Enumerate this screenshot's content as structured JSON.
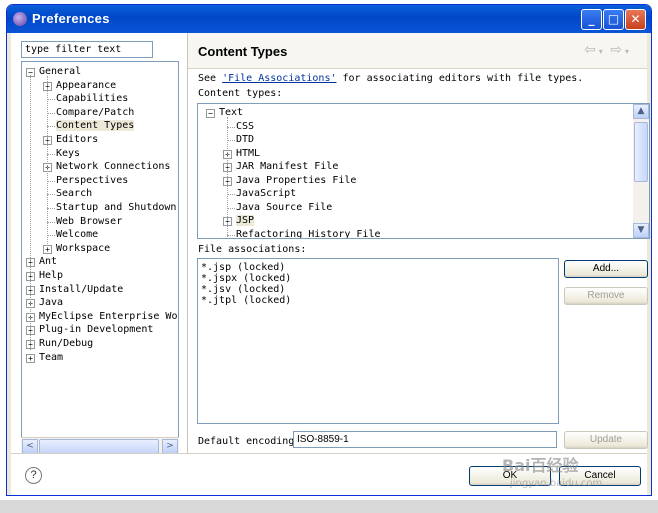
{
  "window": {
    "title": "Preferences",
    "buttons": {
      "minimize": "_",
      "maximize": "□",
      "close": "✕"
    }
  },
  "left": {
    "filter_value": "type filter text",
    "tree": [
      {
        "label": "General",
        "indent": 0,
        "expander": "−"
      },
      {
        "label": "Appearance",
        "indent": 1,
        "expander": "+"
      },
      {
        "label": "Capabilities",
        "indent": 1,
        "expander": ""
      },
      {
        "label": "Compare/Patch",
        "indent": 1,
        "expander": ""
      },
      {
        "label": "Content Types",
        "indent": 1,
        "expander": "",
        "selected": true
      },
      {
        "label": "Editors",
        "indent": 1,
        "expander": "+"
      },
      {
        "label": "Keys",
        "indent": 1,
        "expander": ""
      },
      {
        "label": "Network Connections",
        "indent": 1,
        "expander": "+"
      },
      {
        "label": "Perspectives",
        "indent": 1,
        "expander": ""
      },
      {
        "label": "Search",
        "indent": 1,
        "expander": ""
      },
      {
        "label": "Startup and Shutdown",
        "indent": 1,
        "expander": ""
      },
      {
        "label": "Web Browser",
        "indent": 1,
        "expander": ""
      },
      {
        "label": "Welcome",
        "indent": 1,
        "expander": ""
      },
      {
        "label": "Workspace",
        "indent": 1,
        "expander": "+"
      },
      {
        "label": "Ant",
        "indent": 0,
        "expander": "+"
      },
      {
        "label": "Help",
        "indent": 0,
        "expander": "+"
      },
      {
        "label": "Install/Update",
        "indent": 0,
        "expander": "+"
      },
      {
        "label": "Java",
        "indent": 0,
        "expander": "+"
      },
      {
        "label": "MyEclipse Enterprise Work",
        "indent": 0,
        "expander": "+"
      },
      {
        "label": "Plug-in Development",
        "indent": 0,
        "expander": "+"
      },
      {
        "label": "Run/Debug",
        "indent": 0,
        "expander": "+"
      },
      {
        "label": "Team",
        "indent": 0,
        "expander": "+"
      }
    ],
    "scroll_left": "<",
    "scroll_right": ">"
  },
  "right": {
    "title": "Content Types",
    "nav_back": "⇦",
    "nav_forward": "⇨",
    "see_prefix": "See ",
    "see_link": "'File Associations'",
    "see_suffix": " for associating editors with file types.",
    "content_types_label": "Content types:",
    "content_types": [
      {
        "label": "Text",
        "indent": 0,
        "expander": "−"
      },
      {
        "label": "CSS",
        "indent": 1,
        "expander": ""
      },
      {
        "label": "DTD",
        "indent": 1,
        "expander": ""
      },
      {
        "label": "HTML",
        "indent": 1,
        "expander": "+"
      },
      {
        "label": "JAR Manifest File",
        "indent": 1,
        "expander": "+"
      },
      {
        "label": "Java Properties File",
        "indent": 1,
        "expander": "+"
      },
      {
        "label": "JavaScript",
        "indent": 1,
        "expander": ""
      },
      {
        "label": "Java Source File",
        "indent": 1,
        "expander": ""
      },
      {
        "label": "JSP",
        "indent": 1,
        "expander": "+",
        "selected": true
      },
      {
        "label": "Refactoring History File",
        "indent": 1,
        "expander": ""
      }
    ],
    "scroll_up": "▲",
    "scroll_down": "▼",
    "file_assoc_label": "File associations:",
    "file_associations": [
      "*.jsp (locked)",
      "*.jspx (locked)",
      "*.jsv (locked)",
      "*.jtpl (locked)"
    ],
    "add_button": "Add...",
    "remove_button": "Remove",
    "encoding_label": "Default encoding:",
    "encoding_value": "ISO-8859-1",
    "update_button": "Update"
  },
  "footer": {
    "help": "?",
    "ok_button": "OK",
    "cancel_button": "Cancel"
  },
  "watermark": {
    "text": "Bai百经验",
    "url": "jingyan.baidu.com"
  }
}
